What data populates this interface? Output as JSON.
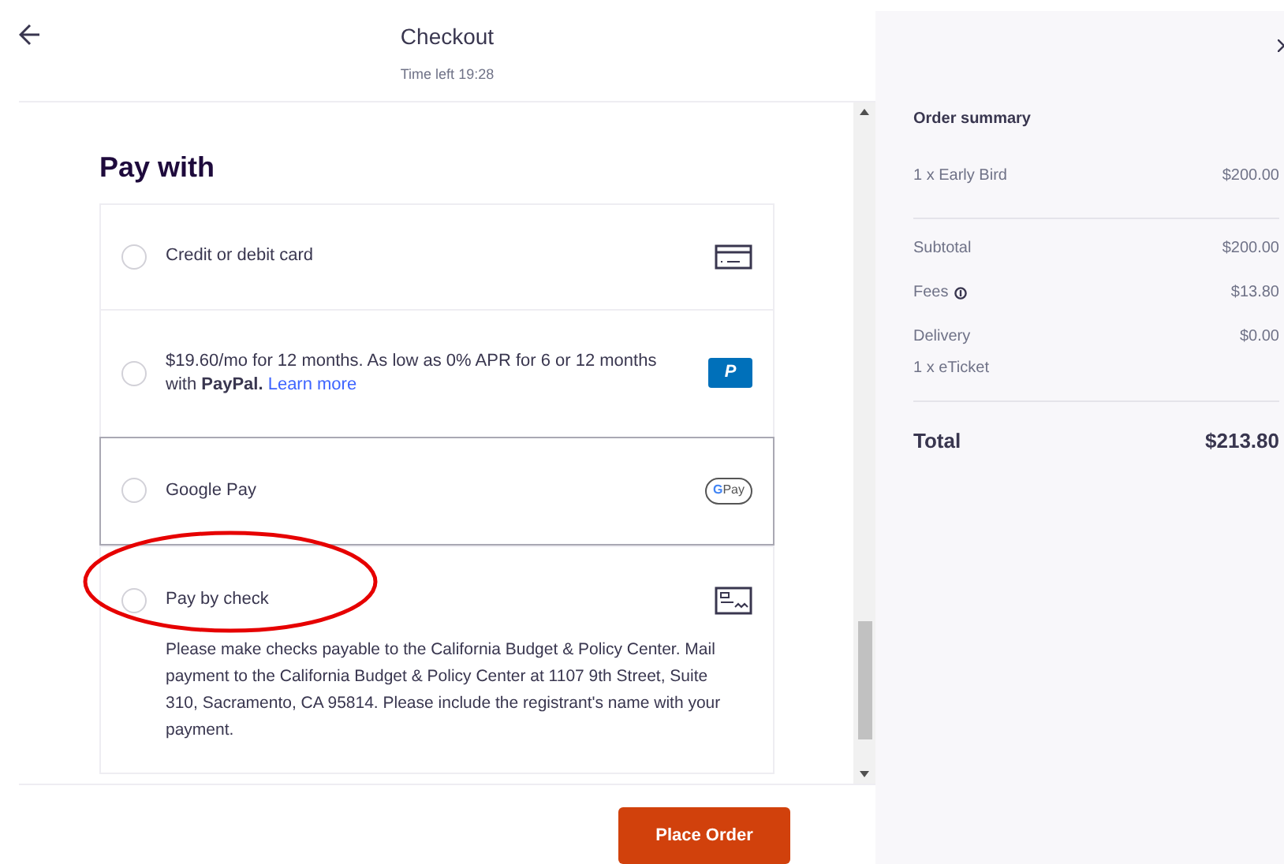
{
  "header": {
    "title": "Checkout",
    "timer": "Time left 19:28"
  },
  "section_title": "Pay with",
  "payment_options": [
    {
      "kind": "card",
      "label": "Credit or debit card",
      "selected": false,
      "highlighted": false
    },
    {
      "kind": "paypal",
      "label": "$19.60/mo for 12 months. As low as 0% APR for 6 or 12 months with **PayPal.**",
      "link": "Learn more",
      "logo_letter": "P",
      "selected": false,
      "highlighted": false
    },
    {
      "kind": "gpay",
      "label": "Google Pay",
      "logo_letter": "G",
      "logo_text": "Pay",
      "selected": false,
      "highlighted": true
    },
    {
      "kind": "check",
      "label": "Pay by check",
      "description": "Please make checks payable to the California Budget & Policy Center. Mail payment to the California Budget & Policy Center at 1107 9th Street, Suite 310, Sacramento, CA 95814. Please include the registrant's name with your payment.",
      "selected": false,
      "highlighted": false
    }
  ],
  "place_order": "Place Order",
  "summary": {
    "title": "Order summary",
    "items": [
      {
        "label": "1 x Early Bird",
        "amount": "$200.00"
      }
    ],
    "lines": [
      {
        "label": "Subtotal",
        "amount": "$200.00",
        "info": false
      },
      {
        "label": "Fees",
        "amount": "$13.80",
        "info": true
      },
      {
        "label": "Delivery",
        "amount": "$0.00",
        "info": false,
        "note": "1 x eTicket"
      }
    ],
    "total_label": "Total",
    "total": "$213.80"
  }
}
